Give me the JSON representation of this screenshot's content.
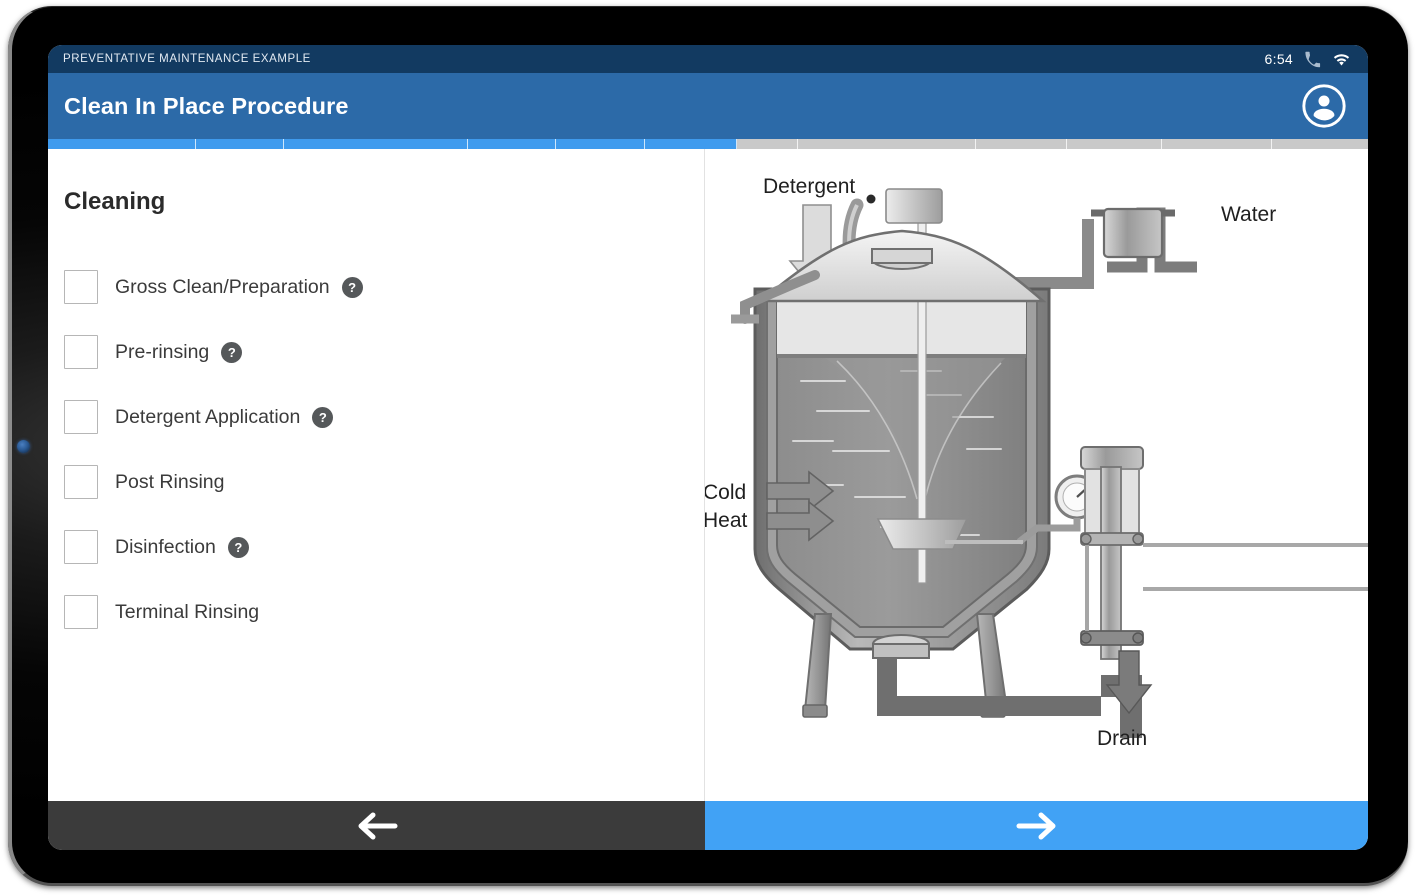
{
  "status_bar": {
    "title": "PREVENTATIVE MAINTENANCE EXAMPLE",
    "time": "6:54",
    "icons": [
      "phone-icon",
      "wifi-icon"
    ]
  },
  "app_bar": {
    "title": "Clean In Place Procedure",
    "avatar_icon": "account-circle-icon",
    "background_color": "#2c6aa8"
  },
  "progress": {
    "completed_color": "#3f9bee",
    "remaining_color": "#c9c9c9",
    "percent_complete": 52,
    "segments": [
      {
        "state": "done",
        "width": 11.2
      },
      {
        "state": "done",
        "width": 6.7
      },
      {
        "state": "done",
        "width": 13.9
      },
      {
        "state": "done",
        "width": 6.7
      },
      {
        "state": "done",
        "width": 6.7
      },
      {
        "state": "done",
        "width": 7.0
      },
      {
        "state": "todo",
        "width": 4.6
      },
      {
        "state": "todo",
        "width": 13.5
      },
      {
        "state": "todo",
        "width": 6.9
      },
      {
        "state": "todo",
        "width": 7.2
      },
      {
        "state": "todo",
        "width": 8.3
      },
      {
        "state": "todo",
        "width": 7.3
      }
    ]
  },
  "left_pane": {
    "section_title": "Cleaning",
    "checklist": [
      {
        "label": "Gross Clean/Preparation",
        "checked": false,
        "has_help": true,
        "help_glyph": "?"
      },
      {
        "label": "Pre-rinsing",
        "checked": false,
        "has_help": true,
        "help_glyph": "?"
      },
      {
        "label": "Detergent Application",
        "checked": false,
        "has_help": true,
        "help_glyph": "?"
      },
      {
        "label": "Post Rinsing",
        "checked": false,
        "has_help": false,
        "help_glyph": "?"
      },
      {
        "label": "Disinfection",
        "checked": false,
        "has_help": true,
        "help_glyph": "?"
      },
      {
        "label": "Terminal Rinsing",
        "checked": false,
        "has_help": false,
        "help_glyph": "?"
      }
    ]
  },
  "right_pane": {
    "diagram_name": "cip-tank-diagram",
    "labels": {
      "detergent": "Detergent",
      "water": "Water",
      "cold": "Cold",
      "heat": "Heat",
      "drain": "Drain"
    }
  },
  "bottom_nav": {
    "back_label": "←",
    "back_icon": "arrow-left-icon",
    "back_color": "#3b3b3b",
    "next_label": "→",
    "next_icon": "arrow-right-icon",
    "next_color": "#41a2f5"
  }
}
